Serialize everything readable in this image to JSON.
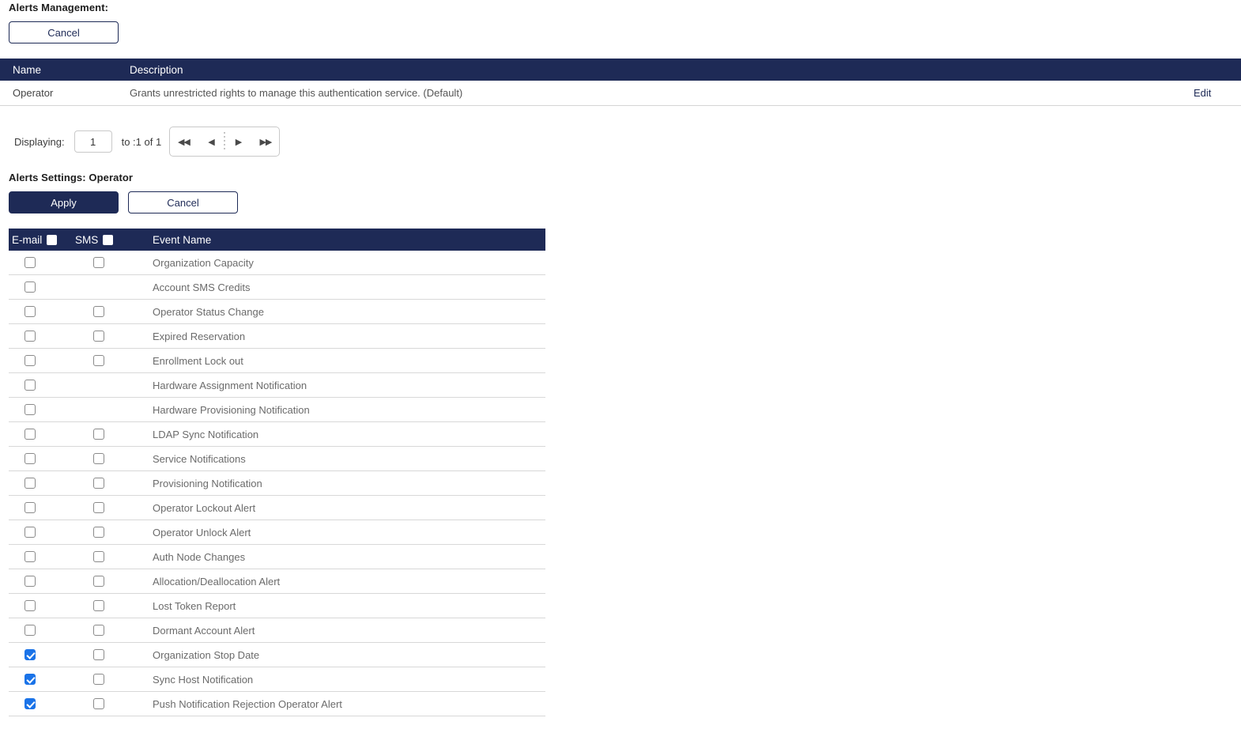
{
  "alerts_management": {
    "title": "Alerts Management:",
    "cancel_label": "Cancel"
  },
  "roles_table": {
    "columns": {
      "name": "Name",
      "description": "Description"
    },
    "edit_label": "Edit",
    "rows": [
      {
        "name": "Operator",
        "description": "Grants unrestricted rights to manage this authentication service. (Default)",
        "edit": "Edit"
      }
    ]
  },
  "pagination": {
    "displaying_label": "Displaying:",
    "current_page": "1",
    "range_label": "to :1 of 1",
    "first_icon": "first-page-icon",
    "prev_icon": "previous-page-icon",
    "next_icon": "next-page-icon",
    "last_icon": "last-page-icon",
    "first_glyph": "◀◀",
    "prev_glyph": "◀",
    "next_glyph": "▶",
    "last_glyph": "▶▶"
  },
  "alerts_settings": {
    "title": "Alerts Settings: Operator",
    "apply_label": "Apply",
    "cancel_label": "Cancel",
    "columns": {
      "email": "E-mail",
      "sms": "SMS",
      "event": "Event Name"
    },
    "header_email_checked": false,
    "header_sms_checked": false,
    "rows": [
      {
        "event": "Organization Capacity",
        "email": false,
        "sms": false,
        "sms_present": true
      },
      {
        "event": "Account SMS Credits",
        "email": false,
        "sms": false,
        "sms_present": false
      },
      {
        "event": "Operator Status Change",
        "email": false,
        "sms": false,
        "sms_present": true
      },
      {
        "event": "Expired Reservation",
        "email": false,
        "sms": false,
        "sms_present": true
      },
      {
        "event": "Enrollment Lock out",
        "email": false,
        "sms": false,
        "sms_present": true
      },
      {
        "event": "Hardware Assignment Notification",
        "email": false,
        "sms": false,
        "sms_present": false
      },
      {
        "event": "Hardware Provisioning Notification",
        "email": false,
        "sms": false,
        "sms_present": false
      },
      {
        "event": "LDAP Sync Notification",
        "email": false,
        "sms": false,
        "sms_present": true
      },
      {
        "event": "Service Notifications",
        "email": false,
        "sms": false,
        "sms_present": true
      },
      {
        "event": "Provisioning Notification",
        "email": false,
        "sms": false,
        "sms_present": true
      },
      {
        "event": "Operator Lockout Alert",
        "email": false,
        "sms": false,
        "sms_present": true
      },
      {
        "event": "Operator Unlock Alert",
        "email": false,
        "sms": false,
        "sms_present": true
      },
      {
        "event": "Auth Node Changes",
        "email": false,
        "sms": false,
        "sms_present": true
      },
      {
        "event": "Allocation/Deallocation Alert",
        "email": false,
        "sms": false,
        "sms_present": true
      },
      {
        "event": "Lost Token Report",
        "email": false,
        "sms": false,
        "sms_present": true
      },
      {
        "event": "Dormant Account Alert",
        "email": false,
        "sms": false,
        "sms_present": true
      },
      {
        "event": "Organization Stop Date",
        "email": true,
        "sms": false,
        "sms_present": true
      },
      {
        "event": "Sync Host Notification",
        "email": true,
        "sms": false,
        "sms_present": true
      },
      {
        "event": "Push Notification Rejection Operator Alert",
        "email": true,
        "sms": false,
        "sms_present": true
      }
    ]
  },
  "colors": {
    "navy": "#1e2a56",
    "checkbox_blue": "#1a73e8",
    "row_border": "#d8d8d8",
    "text_gray": "#6b6b6b"
  }
}
